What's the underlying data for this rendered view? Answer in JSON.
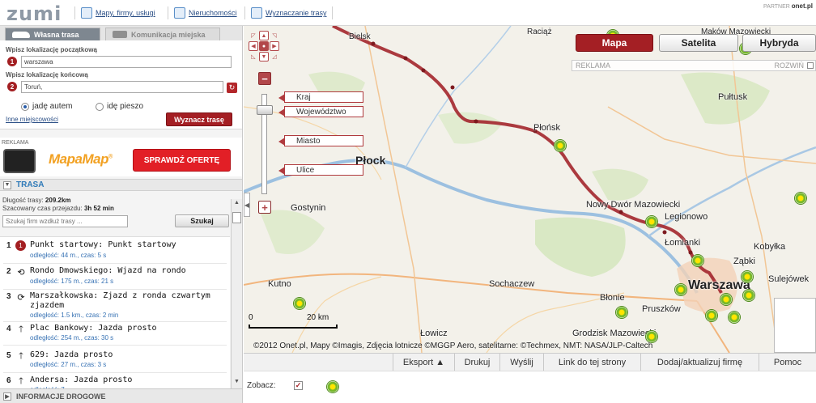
{
  "topbar": {
    "logo": "zumi",
    "links": [
      {
        "label": "Mapy, firmy, usługi"
      },
      {
        "label": "Nieruchomości"
      },
      {
        "label": "Wyznaczanie trasy"
      }
    ],
    "partner_label": "PARTNER",
    "partner_name": "onet.pl"
  },
  "left": {
    "tabs": {
      "own_route": "Własna trasa",
      "public_transport": "Komunikacja miejska"
    },
    "start_label": "Wpisz lokalizację początkową",
    "start_value": "warszawa",
    "end_label": "Wpisz lokalizację końcową",
    "end_value": "Toruń,",
    "pin1": "1",
    "pin2": "2",
    "mode_car": "jadę autem",
    "mode_walk": "idę pieszo",
    "other_places": "Inne miejscowości",
    "route_button": "Wyznacz trasę",
    "ad_label": "REKLAMA",
    "ad_brand": "MapaMap",
    "ad_offer": "SPRAWDŹ OFERTĘ",
    "route_header": "TRASA",
    "route_length_label": "Długość trasy:",
    "route_length": "209.2km",
    "route_time_label": "Szacowany czas przejazdu:",
    "route_time": "3h 52 min",
    "search_placeholder": "Szukaj firm wzdłuż trasy ...",
    "search_button": "Szukaj",
    "steps": [
      {
        "num": "1",
        "title": "Punkt startowy: Punkt startowy",
        "meta": "odległość: 44 m., czas: 5 s"
      },
      {
        "num": "2",
        "title": "Rondo Dmowskiego: Wjazd na rondo",
        "meta": "odległość: 175 m., czas: 21 s"
      },
      {
        "num": "3",
        "title": "Marszałkowska: Zjazd z ronda czwartym zjazdem",
        "meta": "odległość: 1.5 km., czas: 2 min"
      },
      {
        "num": "4",
        "title": "Plac Bankowy: Jazda prosto",
        "meta": "odległość: 254 m., czas: 30 s"
      },
      {
        "num": "5",
        "title": "629: Jazda prosto",
        "meta": "odległość: 27 m., czas: 3 s"
      },
      {
        "num": "6",
        "title": "Andersa: Jazda prosto",
        "meta": "odległość: 7..."
      }
    ],
    "info_bar": "INFORMACJE DROGOWE"
  },
  "map": {
    "type_buttons": {
      "map": "Mapa",
      "satellite": "Satelita",
      "hybrid": "Hybryda"
    },
    "ad_strip": "REKLAMA",
    "expand": "ROZWIŃ",
    "zoom_levels": {
      "country": "Kraj",
      "voivodeship": "Województwo",
      "city": "Miasto",
      "streets": "Ulice"
    },
    "places": {
      "plock": "Płock",
      "plonsk": "Płońsk",
      "pultusk": "Pułtusk",
      "gostynin": "Gostynin",
      "nowy_dwor": "Nowy Dwór Mazowiecki",
      "legionowo": "Legionowo",
      "lomianki": "Łomianki",
      "zabki": "Ząbki",
      "kobylka": "Kobyłka",
      "sulejowek": "Sulejówek",
      "kutno": "Kutno",
      "sochaczew": "Sochaczew",
      "blonie": "Błonie",
      "pruszkow": "Pruszków",
      "warszawa": "Warszawa",
      "grodzisk": "Grodzisk Mazowiecki",
      "lowicz": "Łowicz",
      "makow": "Maków Mazowiecki",
      "bielsk": "Bielsk",
      "raciaz": "Raciąż"
    },
    "scale_zero": "0",
    "scale_value": "20 km",
    "copyright": "©2012 Onet.pl, Mapy ©Imagis, Zdjęcia lotnicze ©MGGP Aero, satelitarne: ©Techmex, NMT: NASA/JLP-Caltech"
  },
  "toolbar": {
    "export": "Eksport ▲",
    "print": "Drukuj",
    "send": "Wyślij",
    "link": "Link do tej strony",
    "add_company": "Dodaj/aktualizuj firmę",
    "help": "Pomoc"
  },
  "legend": {
    "label": "Zobacz:",
    "check": "✓"
  }
}
